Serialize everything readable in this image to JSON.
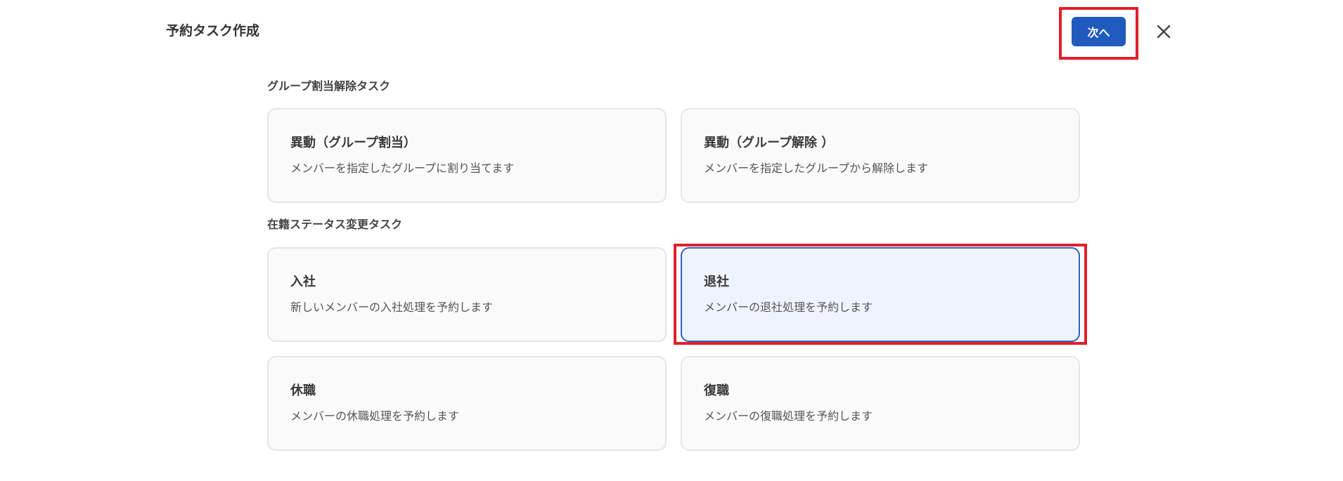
{
  "header": {
    "title": "予約タスク作成",
    "next_label": "次へ",
    "close_icon": "close-icon"
  },
  "sections": [
    {
      "title": "グループ割当解除タスク",
      "cards": [
        {
          "title": "異動（グループ割当）",
          "description": "メンバーを指定したグループに割り当てます"
        },
        {
          "title": "異動（グループ解除 ）",
          "description": "メンバーを指定したグループから解除します"
        }
      ]
    },
    {
      "title": "在籍ステータス変更タスク",
      "cards": [
        {
          "title": "入社",
          "description": "新しいメンバーの入社処理を予約します"
        },
        {
          "title": "退社",
          "description": "メンバーの退社処理を予約します",
          "selected": true
        },
        {
          "title": "休職",
          "description": "メンバーの休職処理を予約します"
        },
        {
          "title": "復職",
          "description": "メンバーの復職処理を予約します"
        }
      ]
    }
  ],
  "colors": {
    "primary": "#1f5bbe",
    "highlight": "#e0202b",
    "selected_bg": "#eef3fd",
    "selected_border": "#2d62c2"
  }
}
